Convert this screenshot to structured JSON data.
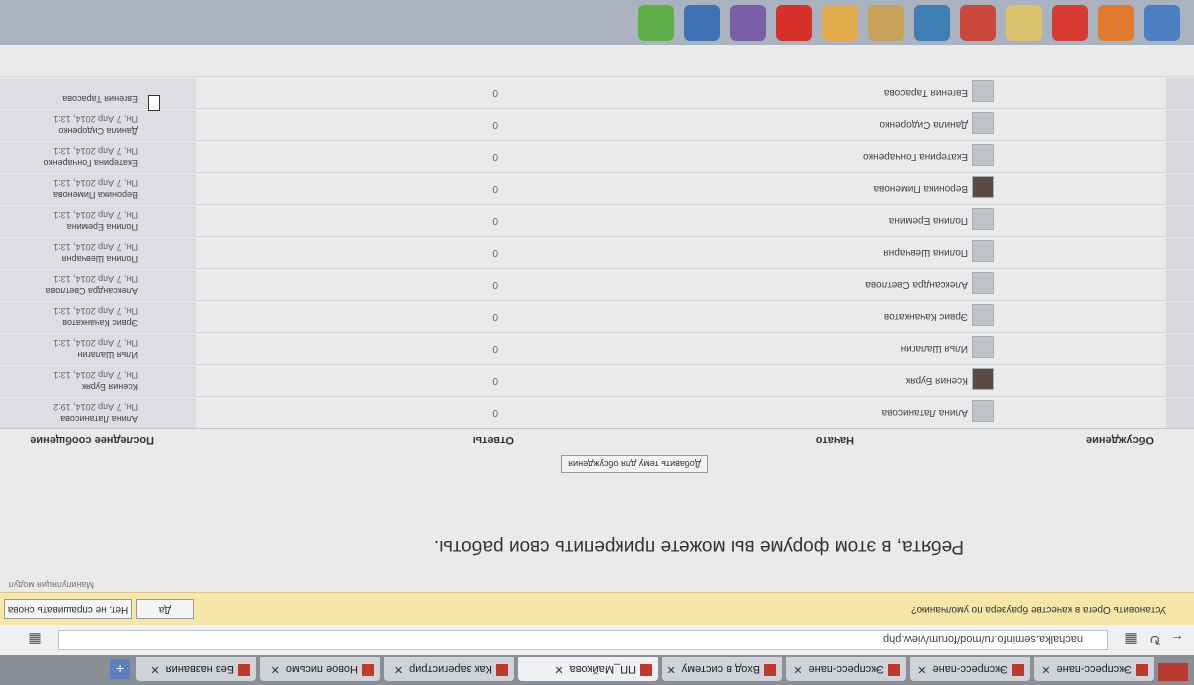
{
  "tabs": [
    {
      "label": "Экспресс-пане"
    },
    {
      "label": "Экспресс-пане"
    },
    {
      "label": "Экспресс-пане"
    },
    {
      "label": "Вход в систему"
    },
    {
      "label": "ПП_Майкова"
    },
    {
      "label": "Как зарегистрир"
    },
    {
      "label": "Новое письмо"
    },
    {
      "label": "Без названия"
    }
  ],
  "address": {
    "url": "nachalka.seminfo.ru/mod/forum/view.php"
  },
  "infobar": {
    "message": "Установить Opera в качестве браузера по умолчанию?",
    "yes": "Да",
    "no": "Нет, не спрашивать снова"
  },
  "bookmark": "Манипуляция модул",
  "page": {
    "heading": "Ребята, в этом форуме вы можете прикрепить свои работы.",
    "add_topic": "Добавить тему для обсуждения"
  },
  "table": {
    "columns": {
      "discussion": "Обсуждение",
      "started_by": "Начато",
      "replies": "Ответы",
      "last_post": "Последнее сообщение"
    },
    "rows": [
      {
        "author": "Алина Латанисова",
        "replies": "0",
        "last_name": "Алина Латанисова",
        "last_date": "Пн, 7 Апр 2014, 19:2"
      },
      {
        "author": "Ксения Буряк",
        "replies": "0",
        "last_name": "Ксения Буряк",
        "last_date": "Пн, 7 Апр 2014, 13:1"
      },
      {
        "author": "Илья Шалагин",
        "replies": "0",
        "last_name": "Илья Шалагин",
        "last_date": "Пн, 7 Апр 2014, 13:1"
      },
      {
        "author": "Эрвис Качанкатов",
        "replies": "0",
        "last_name": "Эрвис Качанкатов",
        "last_date": "Пн, 7 Апр 2014, 13:1"
      },
      {
        "author": "Александра Светлова",
        "replies": "0",
        "last_name": "Александра Светлова",
        "last_date": "Пн, 7 Апр 2014, 13:1"
      },
      {
        "author": "Полина Шевчарня",
        "replies": "0",
        "last_name": "Полина Шевчарня",
        "last_date": "Пн, 7 Апр 2014, 13:1"
      },
      {
        "author": "Полина Еремина",
        "replies": "0",
        "last_name": "Полина Еремина",
        "last_date": "Пн, 7 Апр 2014, 13:1"
      },
      {
        "author": "Вероника Пименова",
        "replies": "0",
        "last_name": "Вероника Пименова",
        "last_date": "Пн, 7 Апр 2014, 13:1"
      },
      {
        "author": "Екатерина Гончаренко",
        "replies": "0",
        "last_name": "Екатерина Гончаренко",
        "last_date": "Пн, 7 Апр 2014, 13:1"
      },
      {
        "author": "Данила Сидоренко",
        "replies": "0",
        "last_name": "Данила Сидоренко",
        "last_date": "Пн, 7 Апр 2014, 13:1"
      },
      {
        "author": "Евгения Тарасова",
        "replies": "0",
        "last_name": "Евгения Тарасова",
        "last_date": ""
      }
    ]
  },
  "taskbar": {
    "icons": [
      "chrome-icon",
      "firefox-icon",
      "yandex-icon",
      "word-icon",
      "explorer-icon",
      "paint-icon",
      "folder-icon",
      "opera-icon",
      "browser-icon",
      "disc-icon",
      "media-icon",
      "android-icon"
    ]
  }
}
